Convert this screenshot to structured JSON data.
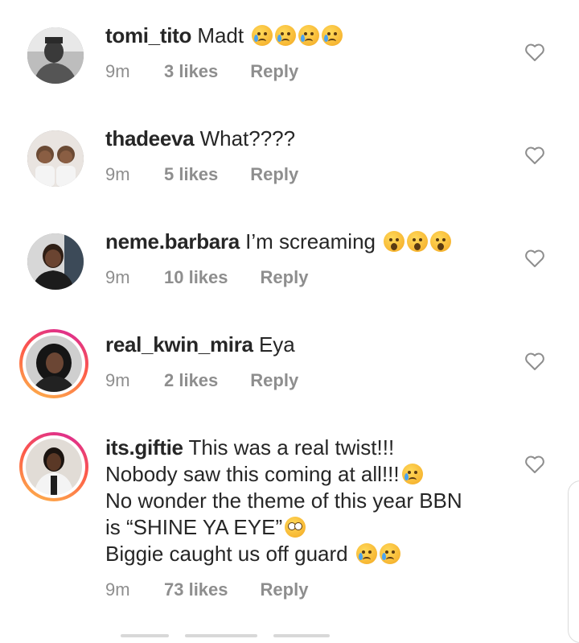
{
  "comments": [
    {
      "username": "tomi_tito",
      "text": "Madt",
      "emojis": [
        "crying-face",
        "crying-face",
        "crying-face",
        "crying-face"
      ],
      "time": "9m",
      "likes": "3 likes",
      "reply": "Reply",
      "story_ring": false
    },
    {
      "username": "thadeeva",
      "text": "What????",
      "emojis": [],
      "time": "9m",
      "likes": "5 likes",
      "reply": "Reply",
      "story_ring": false
    },
    {
      "username": "neme.barbara",
      "text": "I’m screaming",
      "emojis": [
        "astonished-face",
        "astonished-face",
        "astonished-face"
      ],
      "time": "9m",
      "likes": "10 likes",
      "reply": "Reply",
      "story_ring": false
    },
    {
      "username": "real_kwin_mira",
      "text": "Eya",
      "emojis": [],
      "time": "9m",
      "likes": "2 likes",
      "reply": "Reply",
      "story_ring": true
    },
    {
      "username": "its.giftie",
      "text_line1": "This was a real twist!!!",
      "text_line2": "Nobody saw this coming at all!!!",
      "text_line3": "No wonder the theme of this year BBN",
      "text_line4": "is “SHINE YA EYE”",
      "text_line5": "Biggie caught us off guard",
      "time": "9m",
      "likes": "73 likes",
      "reply": "Reply",
      "story_ring": true
    }
  ],
  "icons": {
    "like": "heart-outline-icon",
    "emoji_cry": "crying-face-emoji",
    "emoji_shock": "astonished-face-emoji",
    "emoji_plead": "pleading-face-emoji"
  },
  "colors": {
    "text": "#262626",
    "secondary": "#8e8e8e",
    "ring_start": "#d6249f",
    "ring_end": "#fdb84a"
  }
}
